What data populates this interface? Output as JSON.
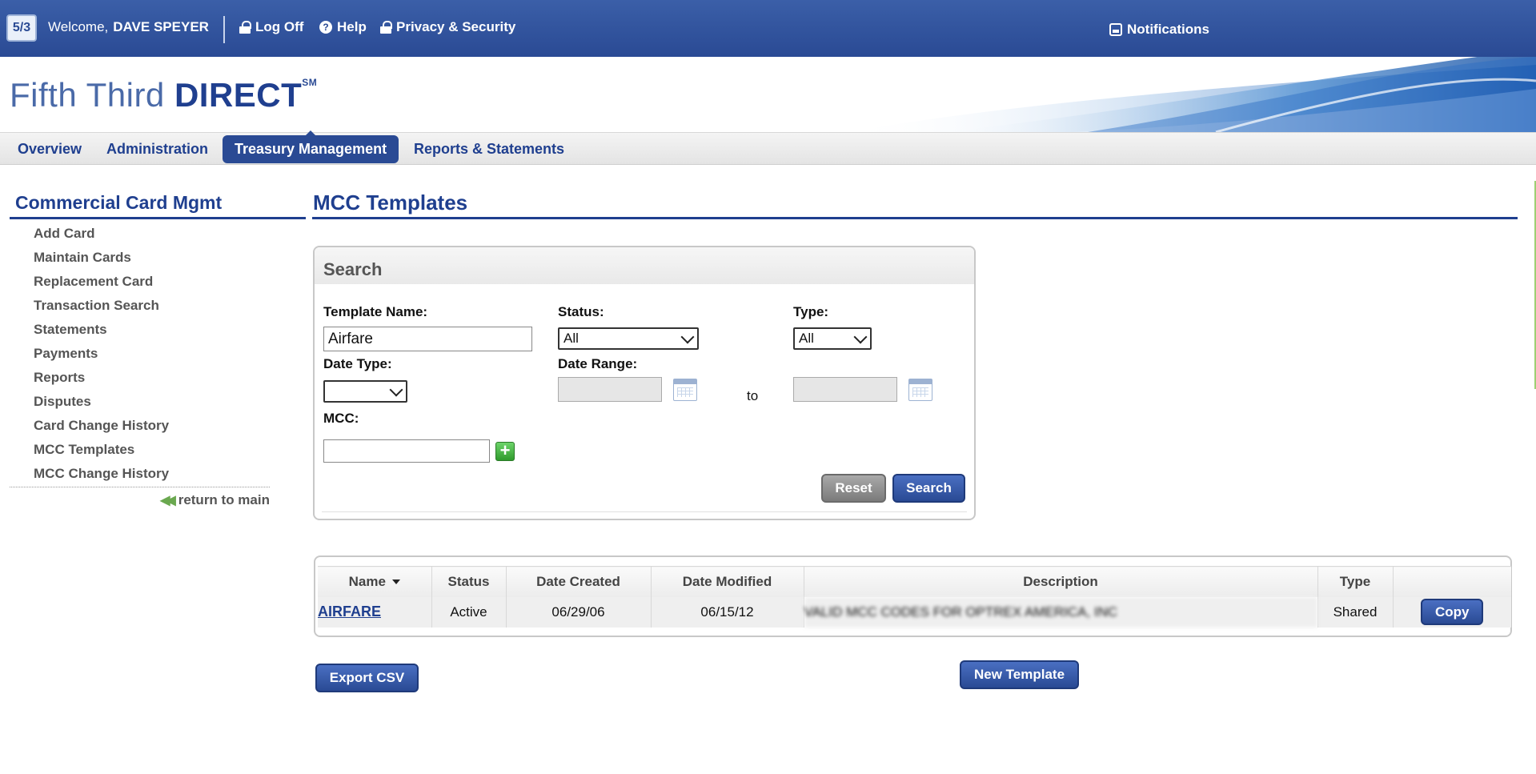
{
  "topbar": {
    "welcome_prefix": "Welcome,",
    "user_name": "DAVE SPEYER",
    "logoff": "Log Off",
    "help": "Help",
    "privacy": "Privacy & Security",
    "notifications": "Notifications",
    "logo_text": "5/3"
  },
  "brand": {
    "light": "Fifth Third ",
    "bold": "DIRECT",
    "mark": "SM"
  },
  "nav": {
    "tabs": [
      {
        "label": "Overview"
      },
      {
        "label": "Administration"
      },
      {
        "label": "Treasury Management",
        "active": true
      },
      {
        "label": "Reports & Statements"
      }
    ]
  },
  "sidebar": {
    "title": "Commercial Card Mgmt",
    "items": [
      {
        "label": "Add Card"
      },
      {
        "label": "Maintain Cards"
      },
      {
        "label": "Replacement Card"
      },
      {
        "label": "Transaction Search"
      },
      {
        "label": "Statements"
      },
      {
        "label": "Payments"
      },
      {
        "label": "Reports"
      },
      {
        "label": "Disputes"
      },
      {
        "label": "Card Change History"
      },
      {
        "label": "MCC Templates"
      },
      {
        "label": "MCC Change History"
      }
    ],
    "return_label": "return to main"
  },
  "main": {
    "title": "MCC Templates"
  },
  "search": {
    "heading": "Search",
    "template_name_label": "Template Name:",
    "template_name_value": "Airfare",
    "status_label": "Status:",
    "status_value": "All",
    "type_label": "Type:",
    "type_value": "All",
    "date_type_label": "Date Type:",
    "date_type_value": "",
    "date_range_label": "Date Range:",
    "date_from": "",
    "date_to": "",
    "to_label": "to",
    "mcc_label": "MCC:",
    "mcc_value": "",
    "reset_label": "Reset",
    "search_label": "Search"
  },
  "results": {
    "columns": [
      "Name",
      "Status",
      "Date Created",
      "Date Modified",
      "Description",
      "Type",
      ""
    ],
    "rows": [
      {
        "name": "AIRFARE",
        "status": "Active",
        "created": "06/29/06",
        "modified": "06/15/12",
        "description": "VALID MCC CODES FOR OPTREX AMERICA, INC",
        "type": "Shared",
        "action": "Copy"
      }
    ]
  },
  "footer_buttons": {
    "export": "Export CSV",
    "new_template": "New Template"
  },
  "colors": {
    "brand_blue": "#2a4a94",
    "accent_green": "#6aa84f"
  }
}
